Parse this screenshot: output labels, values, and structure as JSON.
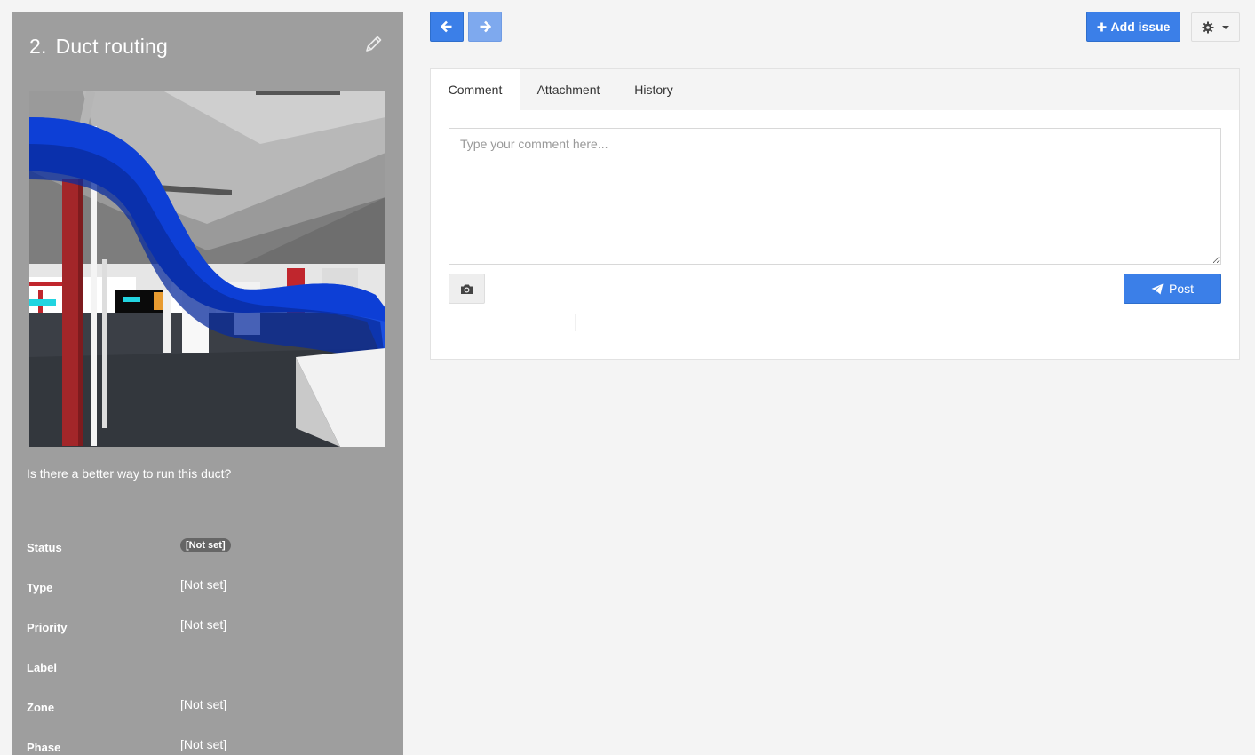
{
  "issue": {
    "number": "2.",
    "title": "Duct routing",
    "description": "Is there a better way to run this duct?",
    "snapshot_alt": "3D model snapshot"
  },
  "properties": {
    "status": {
      "label": "Status",
      "value": "[Not set]"
    },
    "type": {
      "label": "Type",
      "value": "[Not set]"
    },
    "priority": {
      "label": "Priority",
      "value": "[Not set]"
    },
    "label": {
      "label": "Label",
      "value": ""
    },
    "zone": {
      "label": "Zone",
      "value": "[Not set]"
    },
    "phase": {
      "label": "Phase",
      "value": "[Not set]"
    }
  },
  "toolbar": {
    "add_issue_label": "Add issue",
    "prev_icon": "arrow-left-icon",
    "next_icon": "arrow-right-icon",
    "settings_icon": "gear-icon"
  },
  "tabs": [
    {
      "label": "Comment",
      "active": true
    },
    {
      "label": "Attachment",
      "active": false
    },
    {
      "label": "History",
      "active": false
    }
  ],
  "comment": {
    "placeholder": "Type your comment here...",
    "value": "",
    "post_label": "Post",
    "camera_icon": "camera-icon"
  },
  "colors": {
    "primary": "#3b7fe8",
    "panel": "#9e9e9e",
    "background": "#f4f4f4",
    "duct": "#1a4fe0"
  }
}
